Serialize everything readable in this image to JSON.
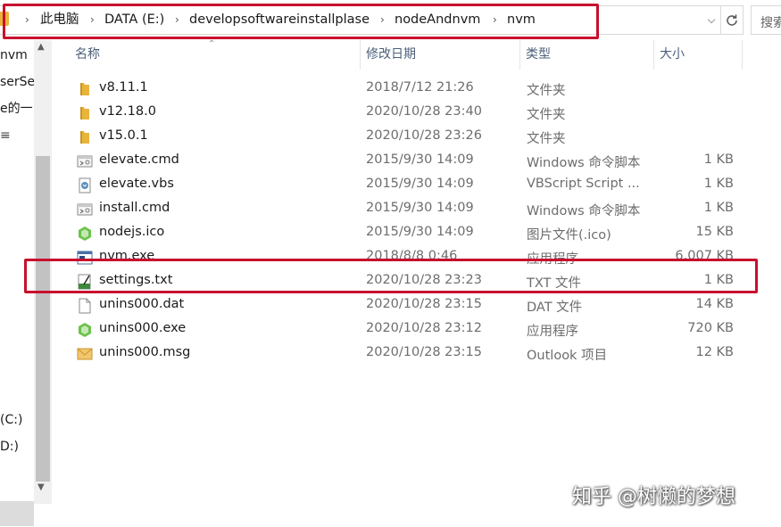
{
  "address_bar": {
    "breadcrumbs": [
      "此电脑",
      "DATA (E:)",
      "developsoftwareinstallplase",
      "nodeAndnvm",
      "nvm"
    ],
    "separator": "›",
    "dropdown_glyph": "⌵",
    "search_placeholder": "搜索"
  },
  "nav_pane": {
    "items": [
      {
        "label": "nvm"
      },
      {
        "label": "serSe"
      },
      {
        "label": "e的一"
      },
      {
        "label": "≡"
      },
      {
        "label": "(C:)"
      },
      {
        "label": "D:)"
      }
    ]
  },
  "columns": {
    "name": "名称",
    "date": "修改日期",
    "type": "类型",
    "size": "大小"
  },
  "files": [
    {
      "name": "v8.11.1",
      "date": "2018/7/12 21:26",
      "type": "文件夹",
      "size": "",
      "icon": "folder-icon"
    },
    {
      "name": "v12.18.0",
      "date": "2020/10/28 23:40",
      "type": "文件夹",
      "size": "",
      "icon": "folder-icon"
    },
    {
      "name": "v15.0.1",
      "date": "2020/10/28 23:26",
      "type": "文件夹",
      "size": "",
      "icon": "folder-icon"
    },
    {
      "name": "elevate.cmd",
      "date": "2015/9/30 14:09",
      "type": "Windows 命令脚本",
      "size": "1 KB",
      "icon": "cmd-file-icon"
    },
    {
      "name": "elevate.vbs",
      "date": "2015/9/30 14:09",
      "type": "VBScript Script ...",
      "size": "1 KB",
      "icon": "vbs-file-icon"
    },
    {
      "name": "install.cmd",
      "date": "2015/9/30 14:09",
      "type": "Windows 命令脚本",
      "size": "1 KB",
      "icon": "cmd-file-icon"
    },
    {
      "name": "nodejs.ico",
      "date": "2015/9/30 14:09",
      "type": "图片文件(.ico)",
      "size": "15 KB",
      "icon": "nodejs-icon"
    },
    {
      "name": "nvm.exe",
      "date": "2018/8/8 0:46",
      "type": "应用程序",
      "size": "6,007 KB",
      "icon": "exe-file-icon"
    },
    {
      "name": "settings.txt",
      "date": "2020/10/28 23:23",
      "type": "TXT 文件",
      "size": "1 KB",
      "icon": "txt-file-icon"
    },
    {
      "name": "unins000.dat",
      "date": "2020/10/28 23:15",
      "type": "DAT 文件",
      "size": "14 KB",
      "icon": "blank-file-icon"
    },
    {
      "name": "unins000.exe",
      "date": "2020/10/28 23:12",
      "type": "应用程序",
      "size": "720 KB",
      "icon": "nodejs-exe-icon"
    },
    {
      "name": "unins000.msg",
      "date": "2020/10/28 23:15",
      "type": "Outlook 项目",
      "size": "12 KB",
      "icon": "mail-icon"
    }
  ],
  "highlight_color": "#c8102e",
  "watermark": "知乎 @树懒的梦想"
}
